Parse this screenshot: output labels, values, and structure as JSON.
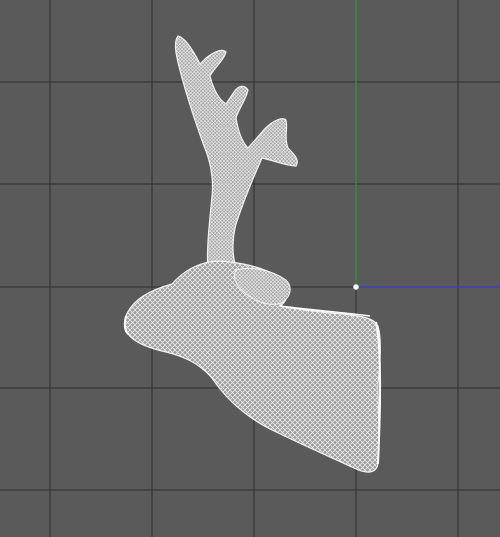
{
  "viewport": {
    "background_color": "#5a5a5a",
    "grid_color": "#2e2e2e",
    "y_axis_color": "#2e9a2e",
    "x_axis_color": "#3a3ac8",
    "mesh_color": "#e6e6e6",
    "mesh_fill_color": "#bdbdbd",
    "shading": "wireframe",
    "grid_visible": true,
    "object_icon": "deer-head-mesh-icon"
  }
}
